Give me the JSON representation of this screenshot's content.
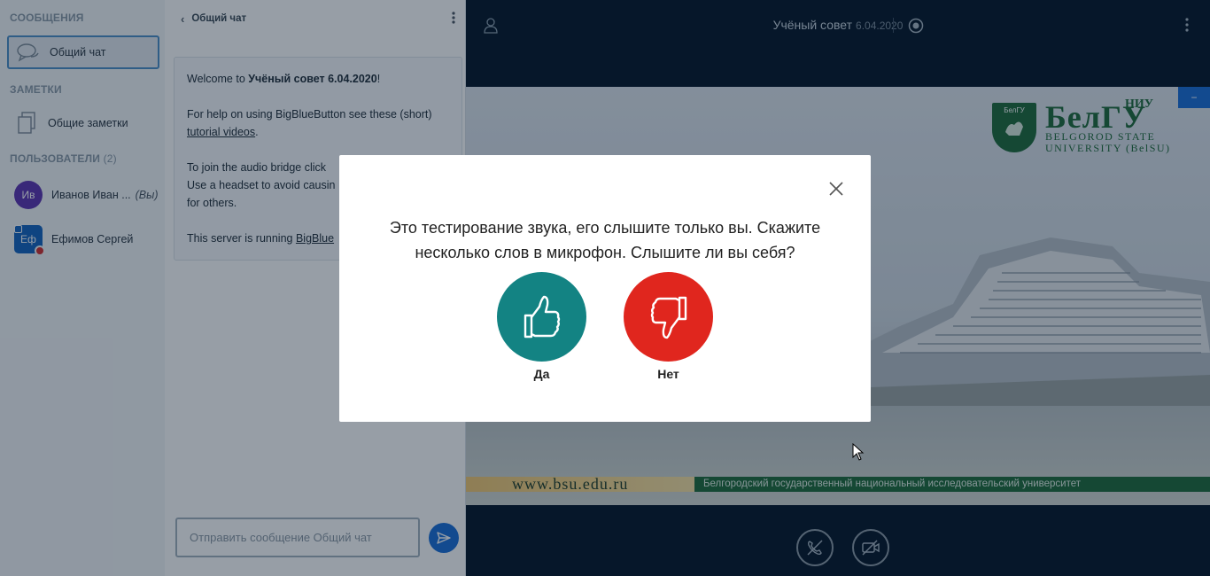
{
  "userlist": {
    "messages_title": "СООБЩЕНИЯ",
    "public_chat_label": "Общий чат",
    "notes_title": "ЗАМЕТКИ",
    "shared_notes_label": "Общие заметки",
    "users_title": "ПОЛЬЗОВАТЕЛИ",
    "users_count": "(2)",
    "users": [
      {
        "initials": "Ив",
        "name": "Иванов Иван ...",
        "you_label": "(Вы)"
      },
      {
        "initials": "Еф",
        "name": "Ефимов Сергей"
      }
    ]
  },
  "chat": {
    "header": "Общий чат",
    "welcome": {
      "l1_pre": "Welcome to ",
      "l1_bold": "Учёный совет 6.04.2020",
      "l1_post": "!",
      "l2_pre": "For help on using BigBlueButton see these (short) ",
      "l2_link": "tutorial videos",
      "l2_post": ".",
      "l3": "To join the audio bridge click",
      "l4": "Use a headset to avoid causin",
      "l5": "for others.",
      "l6_pre": "This server is running ",
      "l6_link": "BigBlue"
    },
    "input_placeholder": "Отправить сообщение Общий чат"
  },
  "main": {
    "meeting_title": "Учёный совет",
    "meeting_date": "6.04.2020",
    "minimize_label": "−"
  },
  "slide": {
    "emblem_text": "БелГУ",
    "logo_niu": "НИУ",
    "logo_big": "БелГУ",
    "logo_sub1": "BELGOROD STATE",
    "logo_sub2": "UNIVERSITY (BelSU)",
    "footer_url": "www.bsu.edu.ru",
    "footer_univ": "Белгородский государственный национальный исследовательский университет"
  },
  "modal": {
    "question": "Это тестирование звука, его слышите только вы. Скажите несколько слов в микрофон. Слышите ли вы себя?",
    "yes_label": "Да",
    "no_label": "Нет"
  },
  "colors": {
    "yes": "#138383",
    "no": "#e0261e",
    "primary": "#1b6fd8",
    "brand_green": "#1f6b3b"
  }
}
